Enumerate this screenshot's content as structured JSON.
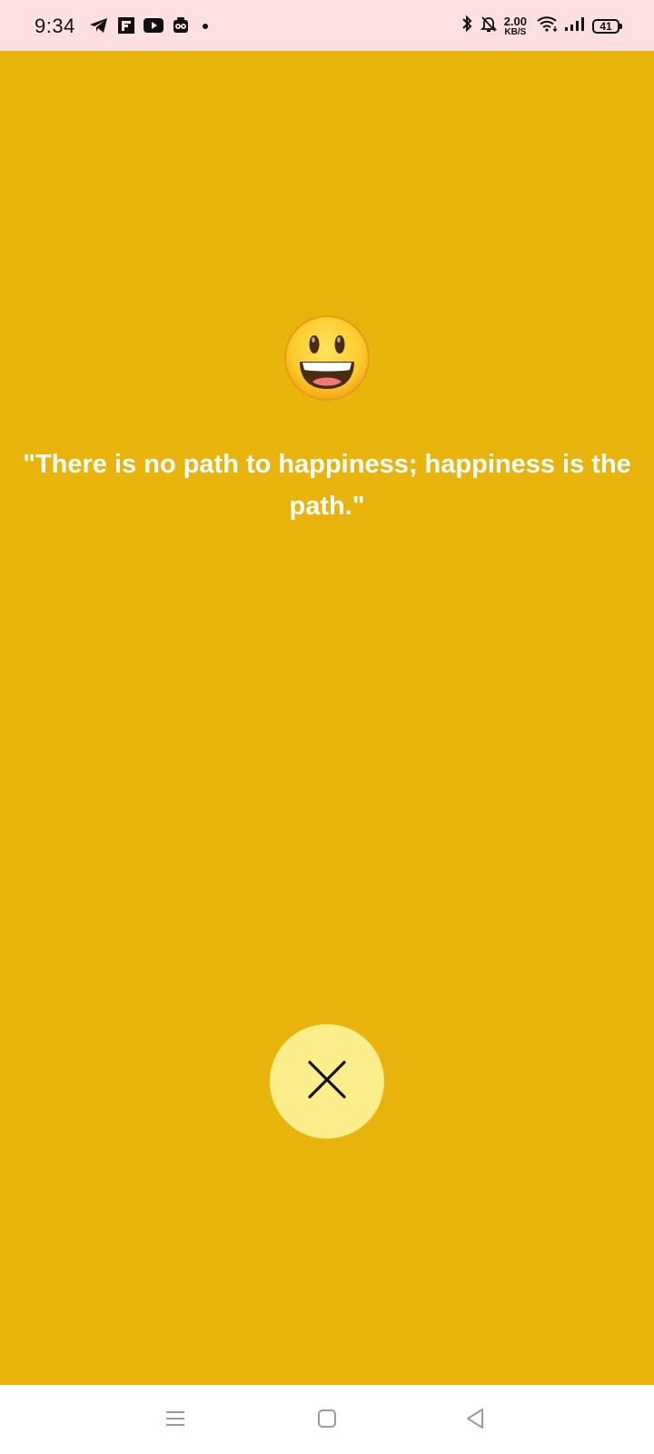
{
  "status_bar": {
    "time": "9:34",
    "network_speed_value": "2.00",
    "network_speed_unit": "KB/S",
    "battery_level": "41",
    "icons": [
      "telegram-icon",
      "flipboard-icon",
      "youtube-icon",
      "app-notification-icon",
      "dot-icon",
      "bluetooth-icon",
      "bell-off-icon",
      "wifi-icon",
      "signal-icon",
      "battery-icon"
    ]
  },
  "main": {
    "emoji": "grinning-face",
    "quote": "\"There is no path to happiness; happiness is the path.\"",
    "background_color": "#E8B30B",
    "close_button_color": "#FCEF8B"
  },
  "nav_bar": {
    "buttons": [
      "menu-icon",
      "home-icon",
      "back-icon"
    ]
  }
}
